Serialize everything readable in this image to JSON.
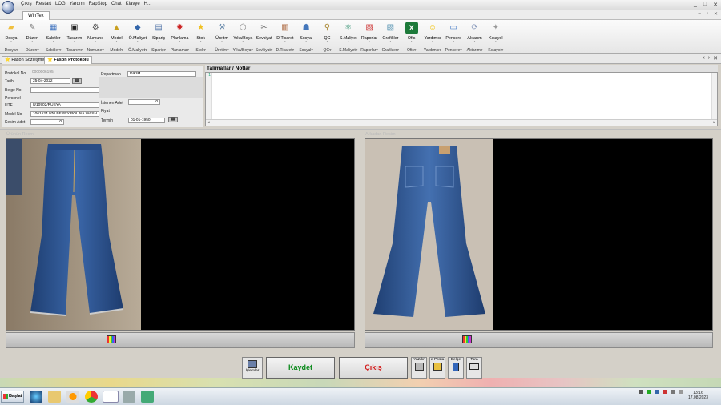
{
  "menubar": {
    "items": [
      "Çıkış",
      "Restart",
      "LOG",
      "Yardım",
      "RapStop",
      "Chat",
      "Klavye",
      "H..."
    ],
    "window_controls": [
      "_",
      "□",
      "✕"
    ]
  },
  "window_tab": "WinTex",
  "ribbon": [
    {
      "label": "Dosya",
      "bottom": "Dosya▾",
      "icon": "folder-icon",
      "color": "#f0c040"
    },
    {
      "label": "Düzen",
      "bottom": "Düzen▾",
      "icon": "edit-icon",
      "color": "#777777"
    },
    {
      "label": "Sabitler",
      "bottom": "Sabitler▾",
      "icon": "constants-icon",
      "color": "#3a6fbd"
    },
    {
      "label": "Tasarım",
      "bottom": "Tasarım▾",
      "icon": "design-icon",
      "color": "#222222"
    },
    {
      "label": "Numune",
      "bottom": "Numune▾",
      "icon": "sample-icon",
      "color": "#555555"
    },
    {
      "label": "Model",
      "bottom": "Model▾",
      "icon": "model-icon",
      "color": "#c9a020"
    },
    {
      "label": "Ö.Maliyet",
      "bottom": "Ö.Maliyet▾",
      "icon": "pre-cost-icon",
      "color": "#3366aa"
    },
    {
      "label": "Sipariş",
      "bottom": "Sipariş▾",
      "icon": "order-icon",
      "color": "#5577aa"
    },
    {
      "label": "Planlama",
      "bottom": "Planlama▾",
      "icon": "planning-icon",
      "color": "#cc2222"
    },
    {
      "label": "Stok",
      "bottom": "Stok▾",
      "icon": "stock-star-icon",
      "color": "#f0c020"
    },
    {
      "label": "Üretim",
      "bottom": "Üretim▾",
      "icon": "production-icon",
      "color": "#6688aa"
    },
    {
      "label": "Yıka/Boya",
      "bottom": "Yıka/Boya▾",
      "icon": "wash-dye-icon",
      "color": "#888888"
    },
    {
      "label": "Sevkiyat",
      "bottom": "Sevkiyat▾",
      "icon": "shipment-icon",
      "color": "#666666"
    },
    {
      "label": "D.Ticaret",
      "bottom": "D.Ticaret▾",
      "icon": "foreign-trade-icon",
      "color": "#a05020"
    },
    {
      "label": "Sosyal",
      "bottom": "Sosyal▾",
      "icon": "social-icon",
      "color": "#4477bb"
    },
    {
      "label": "QC",
      "bottom": "QC▾",
      "icon": "qc-icon",
      "color": "#aa8833"
    },
    {
      "label": "S.Maliyet",
      "bottom": "S.Maliyet▾",
      "icon": "post-cost-icon",
      "color": "#228866"
    },
    {
      "label": "Raporlar",
      "bottom": "Raporlar▾",
      "icon": "reports-icon",
      "color": "#cc3333"
    },
    {
      "label": "Grafikler",
      "bottom": "Grafikler▾",
      "icon": "charts-icon",
      "color": "#4488aa"
    },
    {
      "label": "Ofis",
      "bottom": "Ofis▾",
      "icon": "excel-icon",
      "color": "#1d7a3a"
    },
    {
      "label": "Yardımcı",
      "bottom": "Yardımcı▾",
      "icon": "smiley-icon",
      "color": "#f2c200"
    },
    {
      "label": "Pencere",
      "bottom": "Pencere▾",
      "icon": "window-icon",
      "color": "#3b73c4"
    },
    {
      "label": "Aktarım",
      "bottom": "Aktarım▾",
      "icon": "transfer-icon",
      "color": "#8899bb"
    },
    {
      "label": "Kısayol",
      "bottom": "Kısayol▾",
      "icon": "shortcut-icon",
      "color": "#999999"
    }
  ],
  "tabs": [
    "Fason Sözleşmeleri",
    "Fason Protokolu"
  ],
  "form": {
    "protokol_no_label": "Protokol No",
    "protokol_no": "0000006195",
    "tarih_label": "Tarih",
    "tarih": "25-04-2022",
    "belge_no_label": "Belge No",
    "belge_no": "",
    "personel_label": "Personel",
    "utf_label": "UTF",
    "utf": "8/10902/RUSYA",
    "model_no_label": "Model No",
    "model_no": "1061524 970 BERRY POLINA WASH",
    "kesim_adet_label": "Kesim Adet",
    "kesim_adet": "0",
    "departman_label": "Departman",
    "departman": "DİKİM",
    "istenen_adet_label": "İstenen Adet",
    "istenen_adet": "0",
    "fiyat_label": "Fiyat",
    "termin_label": "Termin",
    "termin": "01-01-1950"
  },
  "notes": {
    "title": "Talimatlar / Notlar",
    "line": "1"
  },
  "images": {
    "left_label": "Ürünün Resmi",
    "right_label": "Arkadan Resim"
  },
  "buttons": {
    "islemler": "İşlemler",
    "kaydet": "Kaydet",
    "cikis": "Çıkış",
    "yazdir": "Yazdır",
    "eposta": "e-Posta",
    "belge": "Belge",
    "tara": "Tara"
  },
  "taskbar": {
    "start": "Başlat",
    "time": "13:16",
    "date": "17.08.2023"
  }
}
